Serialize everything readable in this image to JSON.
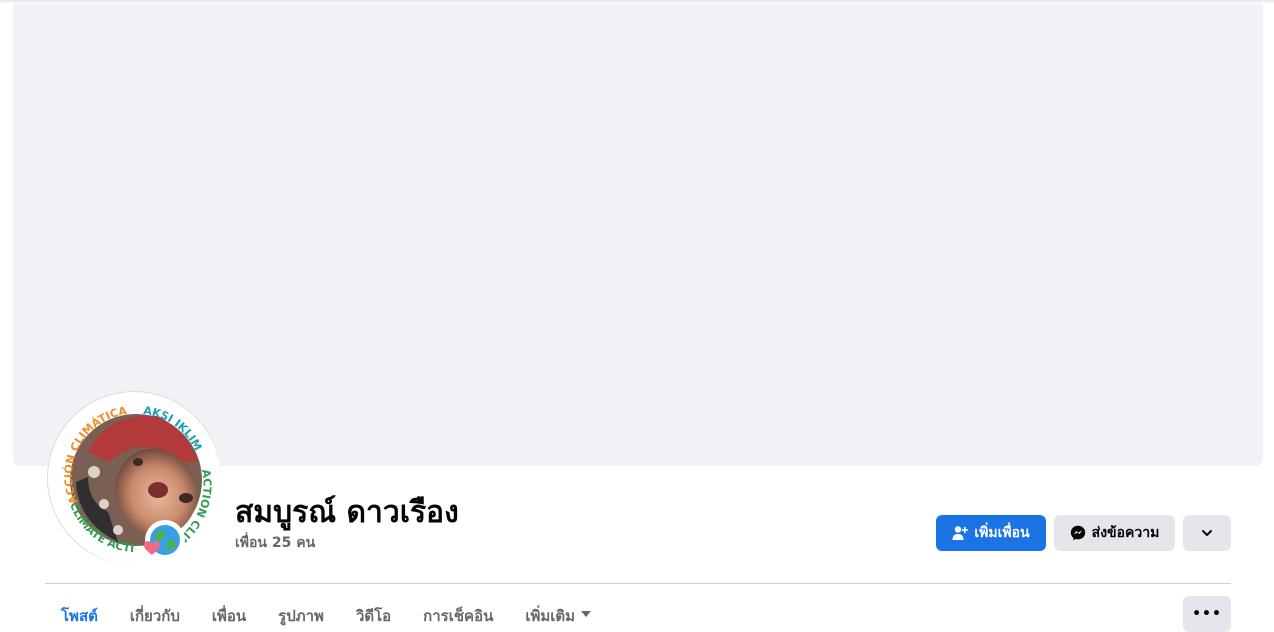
{
  "profile": {
    "name": "สมบูรณ์ ดาวเรือง",
    "friends_count": "เพื่อน 25 คน",
    "frame_texts": [
      "ACCIÓN CLIMÁTICA",
      "AKSI IKLIM",
      "ACTION CLIMAT",
      "CLIMATE ACTION"
    ]
  },
  "actions": {
    "add_friend": "เพิ่มเพื่อน",
    "message": "ส่งข้อความ"
  },
  "tabs": [
    {
      "label": "โพสต์",
      "active": true
    },
    {
      "label": "เกี่ยวกับ"
    },
    {
      "label": "เพื่อน"
    },
    {
      "label": "รูปภาพ"
    },
    {
      "label": "วิดีโอ"
    },
    {
      "label": "การเช็คอิน"
    },
    {
      "label": "เพิ่มเติม"
    }
  ],
  "colors": {
    "accent": "#1b74e4",
    "cover": "#f0f2f5",
    "button_gray": "#e4e6eb"
  },
  "icons": [
    "add-friend-icon",
    "messenger-icon",
    "chevron-down-icon",
    "more-dots-icon",
    "caret-down-icon"
  ]
}
